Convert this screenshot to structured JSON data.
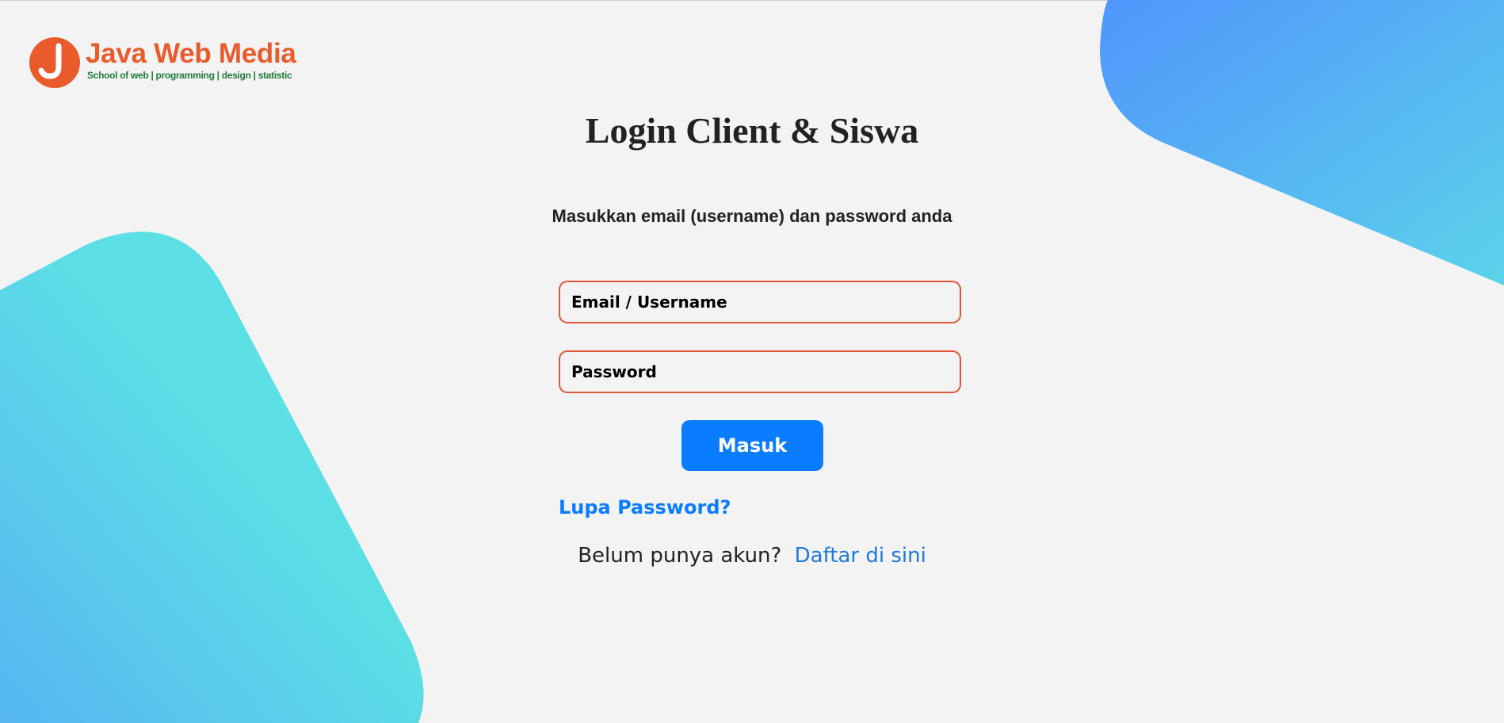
{
  "brand": {
    "name": "Java Web Media",
    "tagline": "School of web | programming | design | statistic",
    "logo_icon": "j-circle-logo-icon",
    "colors": {
      "primary": "#ea5b2c",
      "tagline": "#1f7a3a"
    }
  },
  "login": {
    "title": "Login Client & Siswa",
    "subtitle": "Masukkan email (username) dan password anda",
    "email_placeholder": "Email / Username",
    "password_placeholder": "Password",
    "submit_label": "Masuk",
    "forgot_label": "Lupa Password?",
    "signup_prompt": "Belum punya akun?",
    "signup_link": "Daftar di sini"
  },
  "theme": {
    "accent": "#0a7cff",
    "field_border": "#e0573a",
    "background": "#f3f3f3",
    "decor_gradient": [
      "#4f96fb",
      "#5fe0e4"
    ]
  }
}
